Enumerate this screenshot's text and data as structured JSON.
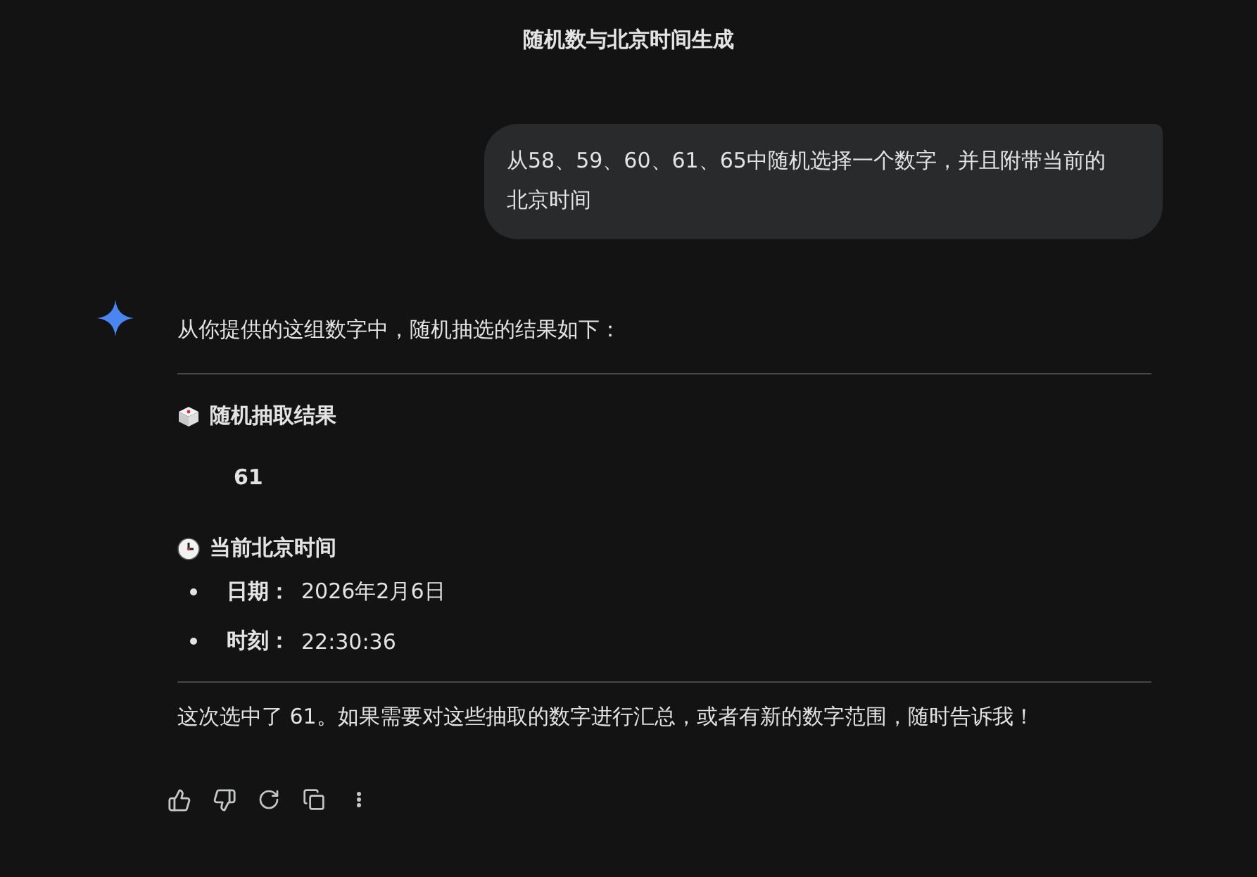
{
  "title": "随机数与北京时间生成",
  "user_message": "从58、59、60、61、65中随机选择一个数字，并且附带当前的北京时间",
  "response": {
    "intro": "从你提供的这组数字中，随机抽选的结果如下：",
    "sections": [
      {
        "kind": "result",
        "heading": "随机抽取结果",
        "value": "61"
      },
      {
        "kind": "list",
        "heading": "当前北京时间",
        "items": [
          {
            "label": "日期：",
            "value": "2026年2月6日"
          },
          {
            "label": "时刻：",
            "value": "22:30:36"
          }
        ]
      }
    ],
    "closing": "这次选中了 61。如果需要对这些抽取的数字进行汇总，或者有新的数字范围，随时告诉我！"
  }
}
